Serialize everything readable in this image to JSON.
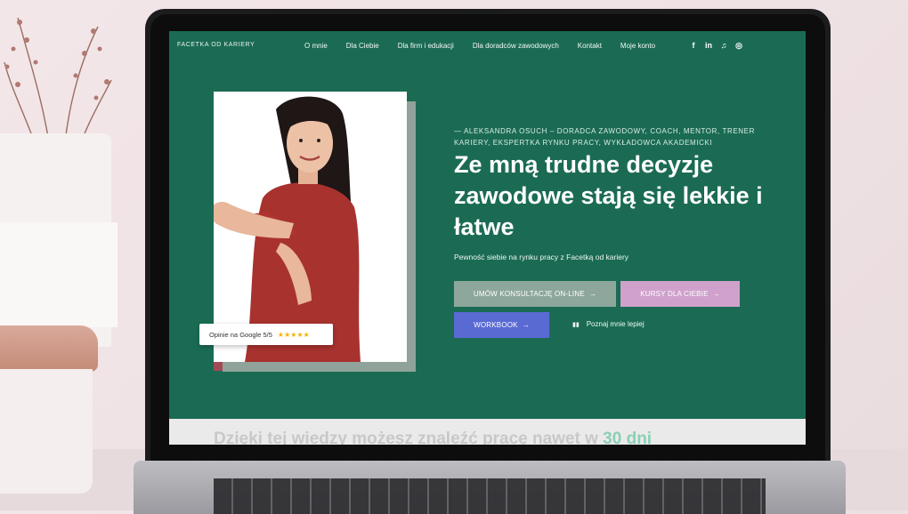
{
  "site": {
    "logo": "FACETKA OD KARIERY",
    "nav": [
      "O mnie",
      "Dla Ciebie",
      "Dla firm i edukacji",
      "Dla doradców zawodowych",
      "Kontakt",
      "Moje konto"
    ],
    "social_icons": [
      "facebook-icon",
      "linkedin-icon",
      "podcast-icon",
      "instagram-icon"
    ],
    "social_glyphs": [
      "f",
      "in",
      "♫",
      "◎"
    ]
  },
  "hero": {
    "eyebrow": "— ALEKSANDRA OSUCH – DORADCA ZAWODOWY, COACH, MENTOR, TRENER KARIERY, EKSPERTKA RYNKU PRACY, WYKŁADOWCA AKADEMICKI",
    "headline": "Ze mną trudne decyzje zawodowe stają się lekkie i łatwe",
    "subtitle": "Pewność siebie na rynku pracy z Facetką od kariery",
    "buttons": {
      "consult": "UMÓW KONSULTACJĘ ON-LINE",
      "courses": "KURSY DLA CIEBIE",
      "workbook": "WORKBOOK"
    },
    "arrow": "→",
    "more_link": "Poznaj mnie lepiej",
    "more_icon": "▮▮",
    "badge_text": "Opinie na Google 5/5",
    "badge_stars": "★★★★★"
  },
  "next_section": {
    "text_before": "Dzięki tej wiedzy możesz znaleźć pracę nawet w ",
    "text_highlight": "30 dni"
  },
  "colors": {
    "hero_bg": "#1b6b54",
    "btn_consult": "#8ea79c",
    "btn_courses": "#cfa1cb",
    "btn_workbook": "#5a6ad3",
    "accent": "#8ad0b5"
  }
}
